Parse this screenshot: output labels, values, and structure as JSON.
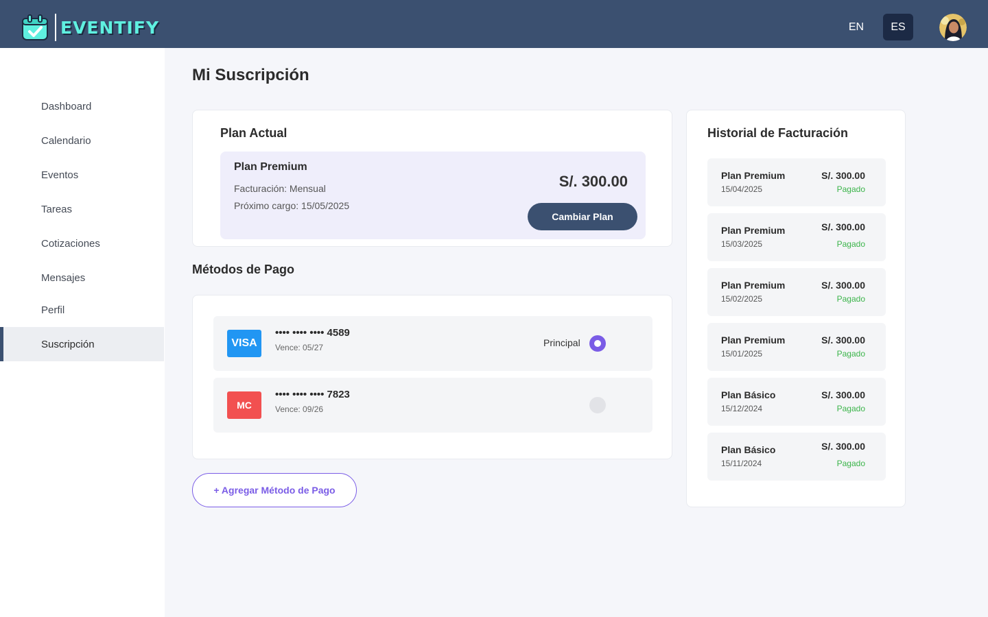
{
  "header": {
    "brand": "EVENTIFY",
    "languages": [
      "EN",
      "ES"
    ],
    "active_language": "ES"
  },
  "sidebar": {
    "items": [
      {
        "label": "Dashboard"
      },
      {
        "label": "Calendario"
      },
      {
        "label": "Eventos"
      },
      {
        "label": "Tareas"
      },
      {
        "label": "Cotizaciones"
      },
      {
        "label": "Mensajes"
      },
      {
        "label": "Perfil"
      },
      {
        "label": "Suscripción",
        "active": true
      }
    ]
  },
  "page": {
    "title": "Mi Suscripción"
  },
  "plan": {
    "section_title": "Plan Actual",
    "name": "Plan Premium",
    "billing": "Facturación: Mensual",
    "next_charge": "Próximo cargo: 15/05/2025",
    "price": "S/. 300.00",
    "change_button": "Cambiar Plan"
  },
  "payment": {
    "section_title": "Métodos de Pago",
    "methods": [
      {
        "brand": "VISA",
        "number": "•••• •••• •••• 4589",
        "expiry": "Vence: 05/27",
        "principal_label": "Principal",
        "selected": true,
        "color": "#2196f3"
      },
      {
        "brand": "MC",
        "number": "•••• •••• •••• 7823",
        "expiry": "Vence: 09/26",
        "selected": false,
        "color": "#f25050"
      }
    ],
    "add_button": "+ Agregar Método de Pago"
  },
  "history": {
    "title": "Historial de Facturación",
    "items": [
      {
        "plan": "Plan Premium",
        "date": "15/04/2025",
        "amount": "S/. 300.00",
        "status": "Pagado"
      },
      {
        "plan": "Plan Premium",
        "date": "15/03/2025",
        "amount": "S/. 300.00",
        "status": "Pagado"
      },
      {
        "plan": "Plan Premium",
        "date": "15/02/2025",
        "amount": "S/. 300.00",
        "status": "Pagado"
      },
      {
        "plan": "Plan Premium",
        "date": "15/01/2025",
        "amount": "S/. 300.00",
        "status": "Pagado"
      },
      {
        "plan": "Plan Básico",
        "date": "15/12/2024",
        "amount": "S/. 300.00",
        "status": "Pagado"
      },
      {
        "plan": "Plan Básico",
        "date": "15/11/2024",
        "amount": "S/. 300.00",
        "status": "Pagado"
      }
    ]
  },
  "colors": {
    "header_bg": "#3b5070",
    "accent": "#7a5ce6",
    "paid_status": "#3bb44a",
    "plan_box_bg": "#efeefb"
  }
}
